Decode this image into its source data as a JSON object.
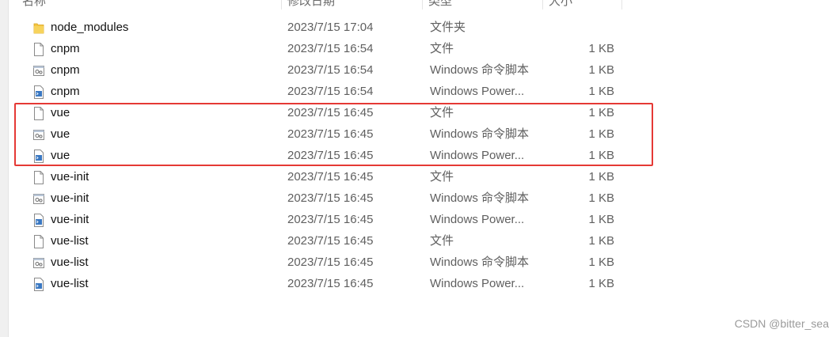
{
  "header": {
    "columns": [
      "名称",
      "修改日期",
      "类型",
      "大小"
    ]
  },
  "files": [
    {
      "icon": "folder-icon",
      "name": "node_modules",
      "date": "2023/7/15 17:04",
      "type": "文件夹",
      "size": ""
    },
    {
      "icon": "blank-file-icon",
      "name": "cnpm",
      "date": "2023/7/15 16:54",
      "type": "文件",
      "size": "1 KB"
    },
    {
      "icon": "cmd-script-icon",
      "name": "cnpm",
      "date": "2023/7/15 16:54",
      "type": "Windows 命令脚本",
      "size": "1 KB"
    },
    {
      "icon": "powershell-icon",
      "name": "cnpm",
      "date": "2023/7/15 16:54",
      "type": "Windows Power...",
      "size": "1 KB"
    },
    {
      "icon": "blank-file-icon",
      "name": "vue",
      "date": "2023/7/15 16:45",
      "type": "文件",
      "size": "1 KB"
    },
    {
      "icon": "cmd-script-icon",
      "name": "vue",
      "date": "2023/7/15 16:45",
      "type": "Windows 命令脚本",
      "size": "1 KB"
    },
    {
      "icon": "powershell-icon",
      "name": "vue",
      "date": "2023/7/15 16:45",
      "type": "Windows Power...",
      "size": "1 KB"
    },
    {
      "icon": "blank-file-icon",
      "name": "vue-init",
      "date": "2023/7/15 16:45",
      "type": "文件",
      "size": "1 KB"
    },
    {
      "icon": "cmd-script-icon",
      "name": "vue-init",
      "date": "2023/7/15 16:45",
      "type": "Windows 命令脚本",
      "size": "1 KB"
    },
    {
      "icon": "powershell-icon",
      "name": "vue-init",
      "date": "2023/7/15 16:45",
      "type": "Windows Power...",
      "size": "1 KB"
    },
    {
      "icon": "blank-file-icon",
      "name": "vue-list",
      "date": "2023/7/15 16:45",
      "type": "文件",
      "size": "1 KB"
    },
    {
      "icon": "cmd-script-icon",
      "name": "vue-list",
      "date": "2023/7/15 16:45",
      "type": "Windows 命令脚本",
      "size": "1 KB"
    },
    {
      "icon": "powershell-icon",
      "name": "vue-list",
      "date": "2023/7/15 16:45",
      "type": "Windows Power...",
      "size": "1 KB"
    }
  ],
  "colors": {
    "highlight": "#e53935",
    "folder": "#f4c542"
  },
  "watermark": "CSDN @bitter_sea"
}
